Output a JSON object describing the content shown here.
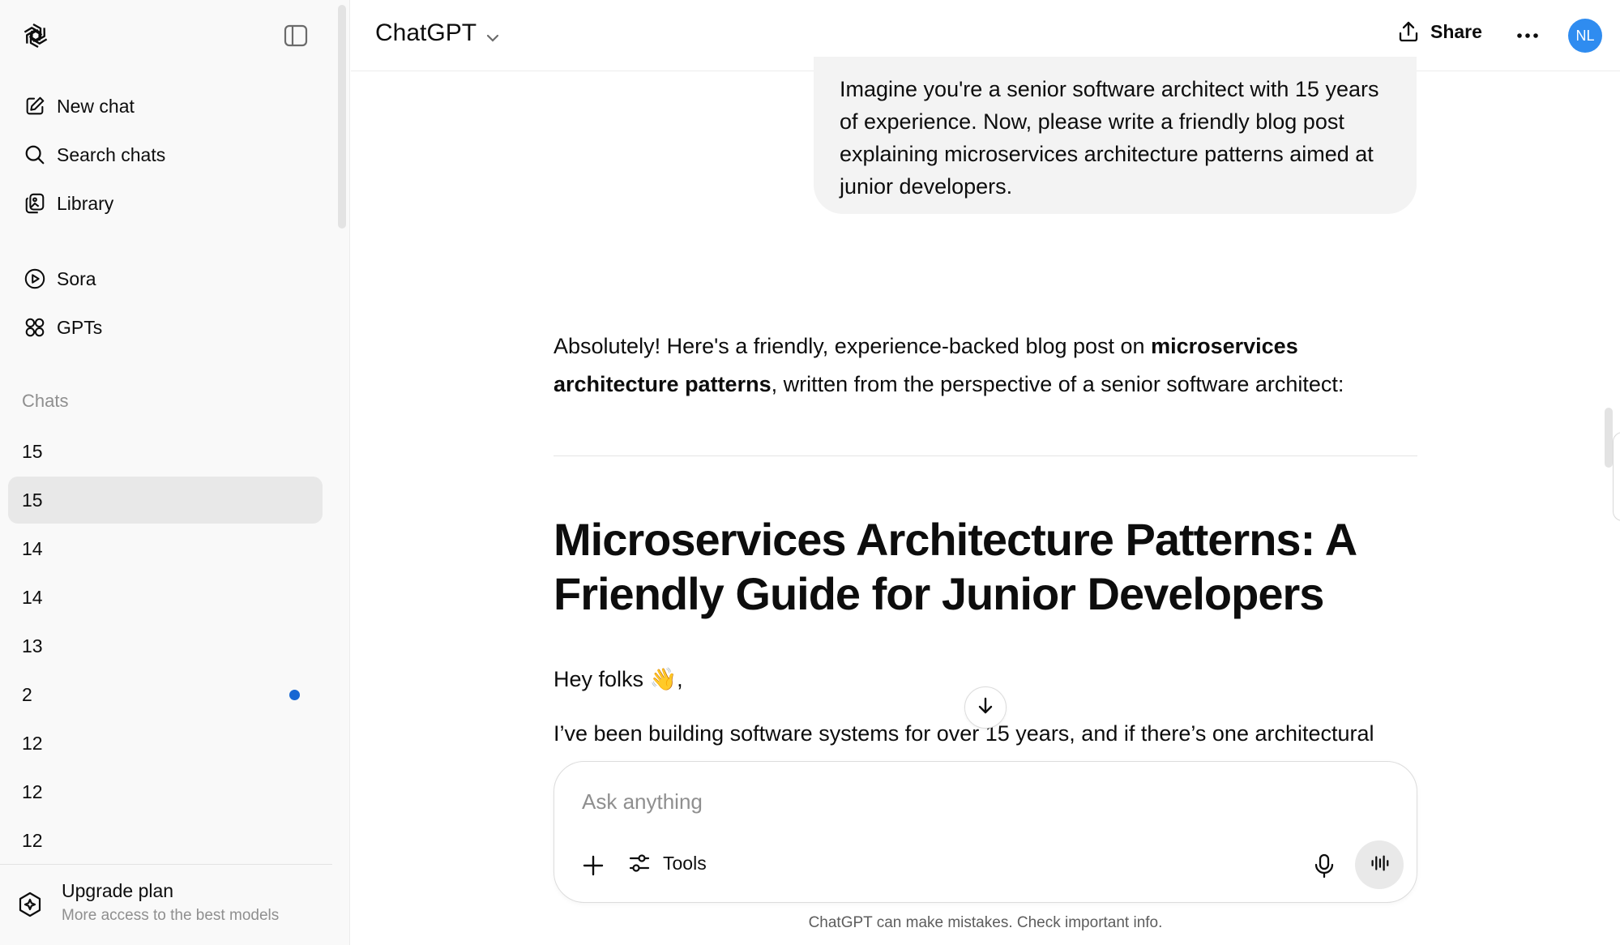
{
  "sidebar": {
    "nav": [
      {
        "label": "New chat",
        "icon": "edit-icon"
      },
      {
        "label": "Search chats",
        "icon": "search-icon"
      },
      {
        "label": "Library",
        "icon": "library-icon"
      },
      {
        "label": "Sora",
        "icon": "play-icon"
      },
      {
        "label": "GPTs",
        "icon": "gpts-grid-icon"
      }
    ],
    "section_label": "Chats",
    "chats": [
      {
        "label": "15",
        "active": false,
        "unread": false
      },
      {
        "label": "15",
        "active": true,
        "unread": false
      },
      {
        "label": "14",
        "active": false,
        "unread": false
      },
      {
        "label": "14",
        "active": false,
        "unread": false
      },
      {
        "label": "13",
        "active": false,
        "unread": false
      },
      {
        "label": "2",
        "active": false,
        "unread": true
      },
      {
        "label": "12",
        "active": false,
        "unread": false
      },
      {
        "label": "12",
        "active": false,
        "unread": false
      },
      {
        "label": "12",
        "active": false,
        "unread": false
      }
    ],
    "upgrade": {
      "title": "Upgrade plan",
      "subtitle": "More access to the best models"
    }
  },
  "header": {
    "model": "ChatGPT",
    "share_label": "Share",
    "avatar_initials": "NL"
  },
  "conversation": {
    "user_message": "Imagine you're a senior software architect with 15 years of experience. Now, please write a friendly blog post explaining microservices architecture patterns aimed at junior developers.",
    "intro_prefix": "Absolutely! Here's a friendly, experience-backed blog post on ",
    "intro_bold": "microservices architecture patterns",
    "intro_suffix": ", written from the perspective of a senior software architect:",
    "post_title": "Microservices Architecture Patterns: A Friendly Guide for Junior Developers",
    "greeting": "Hey folks 👋,",
    "paragraph": "I’ve been building software systems for over 15 years, and if there’s one architectural"
  },
  "composer": {
    "placeholder": "Ask anything",
    "tools_label": "Tools",
    "disclaimer": "ChatGPT can make mistakes. Check important info."
  },
  "colors": {
    "sidebar_bg": "#f9f9f9",
    "active_item_bg": "#e8e8e8",
    "unread_dot": "#1767d3",
    "avatar_bg": "#2f8cf0",
    "user_bubble_bg": "#f3f3f3"
  }
}
